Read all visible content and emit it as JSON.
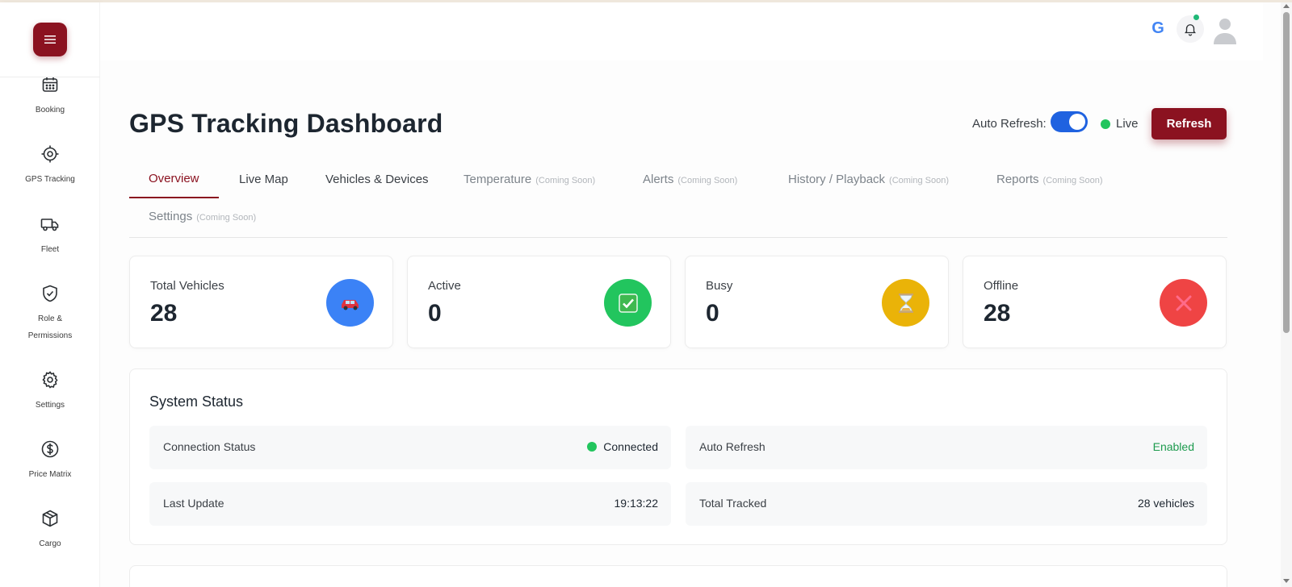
{
  "sidebar": {
    "items": [
      {
        "label": "Booking",
        "icon": "calendar-icon"
      },
      {
        "label": "GPS Tracking",
        "icon": "target-icon"
      },
      {
        "label": "Fleet",
        "icon": "truck-icon"
      },
      {
        "label": "Role & Permissions",
        "icon": "shield-check-icon"
      },
      {
        "label": "Settings",
        "icon": "gear-icon"
      },
      {
        "label": "Price Matrix",
        "icon": "dollar-icon"
      },
      {
        "label": "Cargo",
        "icon": "box-icon"
      }
    ]
  },
  "header": {
    "google_letter": "G",
    "notification_dot_color": "#1fb877"
  },
  "page": {
    "title": "GPS Tracking Dashboard",
    "auto_refresh_label": "Auto Refresh:",
    "auto_refresh_on": true,
    "live_label": "Live",
    "refresh_button": "Refresh"
  },
  "tabs": [
    {
      "label": "Overview",
      "soon": "",
      "active": true
    },
    {
      "label": "Live Map",
      "soon": ""
    },
    {
      "label": "Vehicles & Devices",
      "soon": ""
    },
    {
      "label": "Temperature",
      "soon": "(Coming Soon)"
    },
    {
      "label": "Alerts",
      "soon": "(Coming Soon)"
    },
    {
      "label": "History / Playback",
      "soon": "(Coming Soon)"
    },
    {
      "label": "Reports",
      "soon": "(Coming Soon)"
    },
    {
      "label": "Settings",
      "soon": "(Coming Soon)"
    }
  ],
  "stats": [
    {
      "label": "Total Vehicles",
      "value": "28",
      "icon": "car-icon",
      "color": "#3b82f6"
    },
    {
      "label": "Active",
      "value": "0",
      "icon": "checkmark-icon",
      "color": "#22c55e"
    },
    {
      "label": "Busy",
      "value": "0",
      "icon": "hourglass-icon",
      "color": "#eab308"
    },
    {
      "label": "Offline",
      "value": "28",
      "icon": "x-icon",
      "color": "#ef4444"
    }
  ],
  "system_status": {
    "title": "System Status",
    "rows": [
      {
        "key": "Connection Status",
        "value": "Connected"
      },
      {
        "key": "Auto Refresh",
        "value": "Enabled"
      },
      {
        "key": "Last Update",
        "value": "19:13:22"
      },
      {
        "key": "Total Tracked",
        "value": "28 vehicles"
      }
    ]
  },
  "colors": {
    "brand": "#8b1220",
    "toggle": "#1f62e0",
    "live": "#22c55e",
    "enabled_text": "#1e9b4f"
  }
}
